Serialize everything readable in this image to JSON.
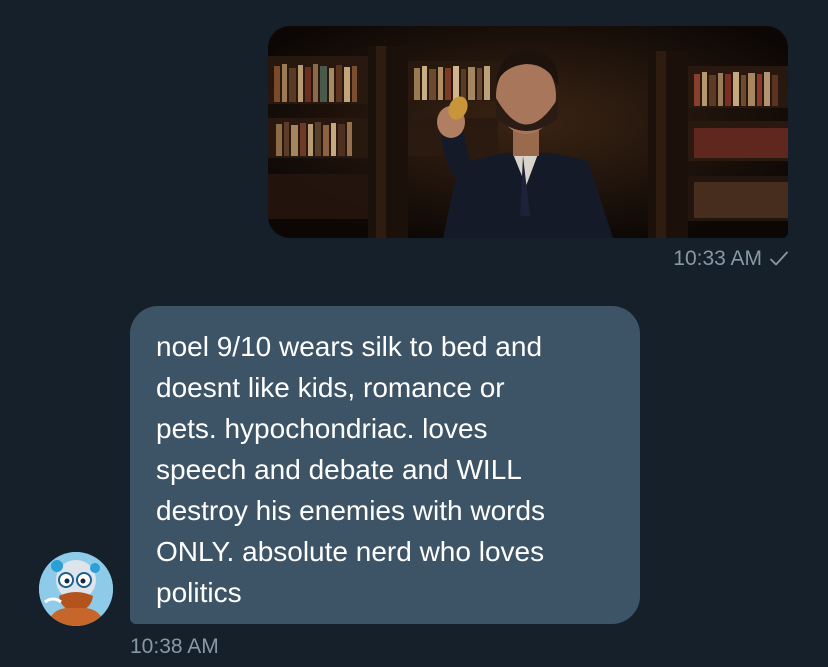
{
  "conversation": {
    "sent": {
      "image_alt": "bearded man in suit holding a small pastry in front of library bookshelves",
      "timestamp": "10:33 AM",
      "status_icon": "check-icon"
    },
    "received": {
      "text": "noel 9/10 wears silk to bed and\ndoesnt like kids, romance or\npets. hypochondriac. loves\nspeech and debate and WILL\ndestroy his enemies with words\nONLY. absolute nerd who loves\npolitics",
      "timestamp": "10:38 AM",
      "avatar_icon": "cartoon-avatar-icon"
    }
  },
  "colors": {
    "background": "#15202b",
    "received_bubble": "#3d5467",
    "timestamp": "#8899a6",
    "message_text": "#ffffff"
  }
}
